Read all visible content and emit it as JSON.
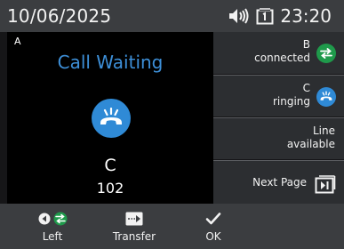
{
  "status_bar": {
    "date": "10/06/2025",
    "time": "23:20",
    "icons": [
      "speaker-icon",
      "lines-icon"
    ]
  },
  "active_call": {
    "line": "A",
    "state": "Call Waiting",
    "caller_name": "C",
    "caller_number": "102",
    "icon": "ringing-phone-icon"
  },
  "side_buttons": [
    {
      "line": "B",
      "status": "connected",
      "icon": "transfer-arrows-icon"
    },
    {
      "line": "C",
      "status": "ringing",
      "icon": "ringing-phone-icon"
    },
    {
      "line": "Line",
      "status": "available",
      "icon": ""
    },
    {
      "label": "Next Page",
      "icon": "next-page-icon"
    }
  ],
  "softkeys": [
    {
      "label": "Left",
      "icon": "left-arrow-transfer-icon"
    },
    {
      "label": "Transfer",
      "icon": "transfer-icon"
    },
    {
      "label": "OK",
      "icon": "check-icon"
    }
  ],
  "colors": {
    "accent_blue": "#2f8ad6",
    "title_blue": "#3d8fd8",
    "connected_green": "#1f9a4b",
    "bar_gray": "#3b3d40",
    "button_gray": "#2c2e31"
  }
}
